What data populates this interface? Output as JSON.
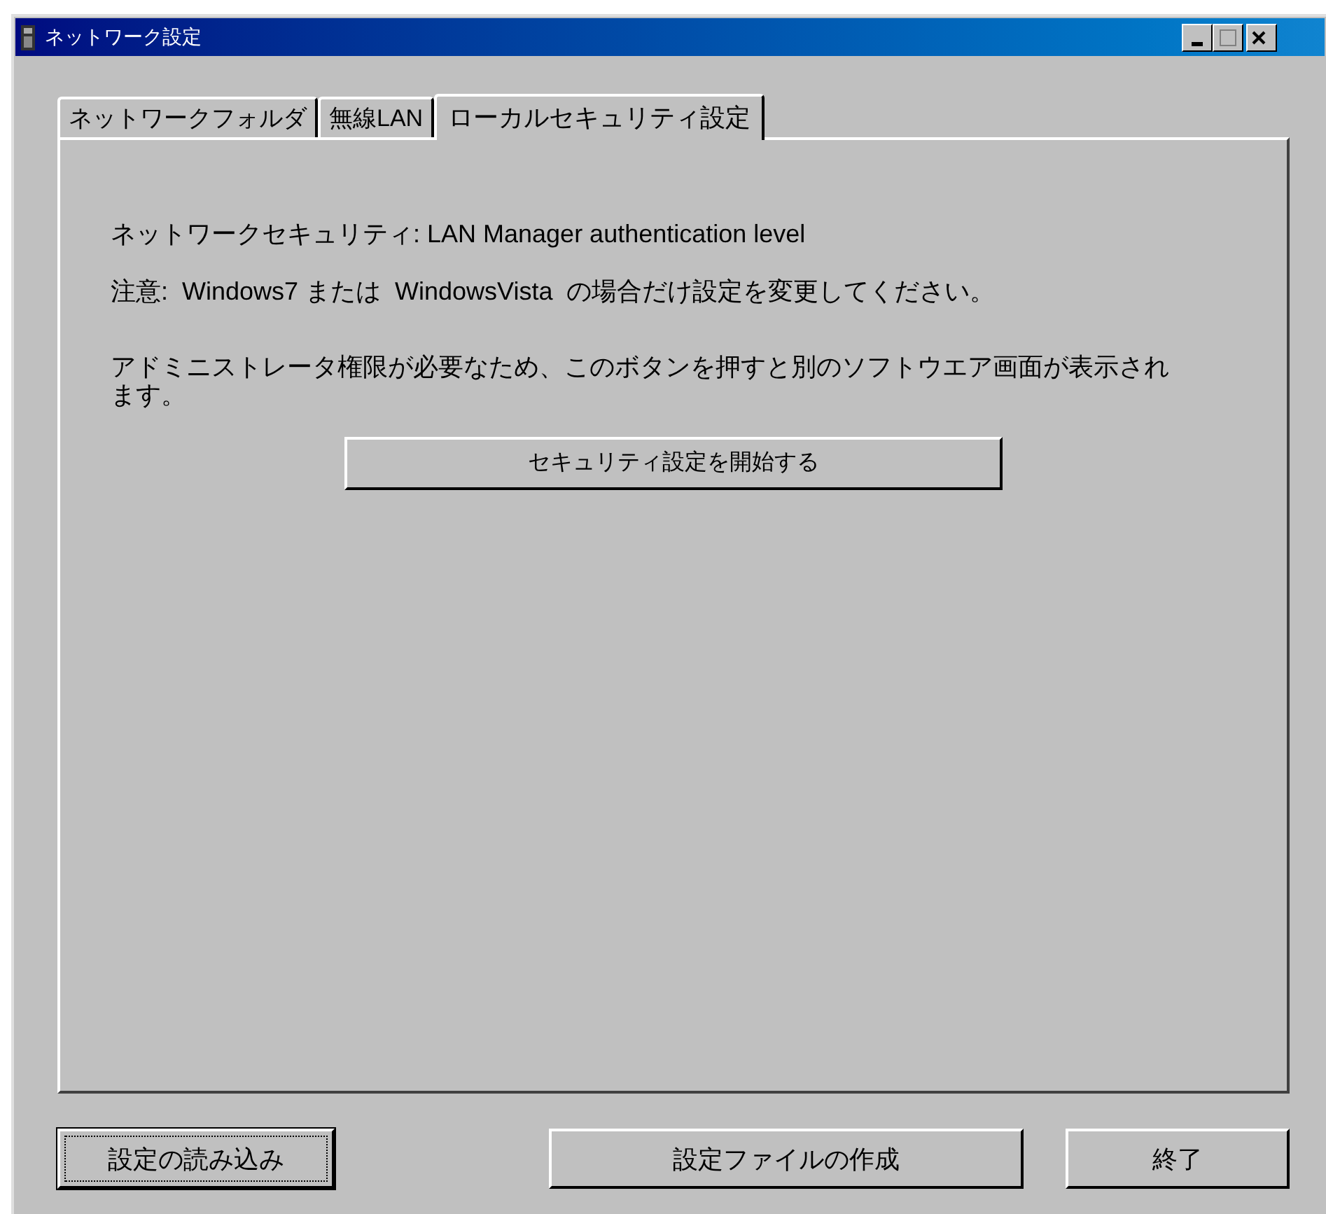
{
  "window": {
    "title": "ネットワーク設定"
  },
  "tabs": [
    {
      "label": "ネットワークフォルダ",
      "selected": false
    },
    {
      "label": "無線LAN",
      "selected": false
    },
    {
      "label": "ローカルセキュリティ設定",
      "selected": true
    }
  ],
  "panel": {
    "heading": "ネットワークセキュリティ: LAN Manager authentication level",
    "note": "注意:  Windows7 または  WindowsVista  の場合だけ設定を変更してください。",
    "description": "アドミニストレータ権限が必要なため、このボタンを押すと別のソフトウエア画面が表示されます。",
    "action": "セキュリティ設定を開始する"
  },
  "buttons": [
    {
      "label": "設定の読み込み",
      "focused": true
    },
    {
      "label": "設定ファイルの作成",
      "focused": false
    },
    {
      "label": "終了",
      "focused": false
    }
  ]
}
